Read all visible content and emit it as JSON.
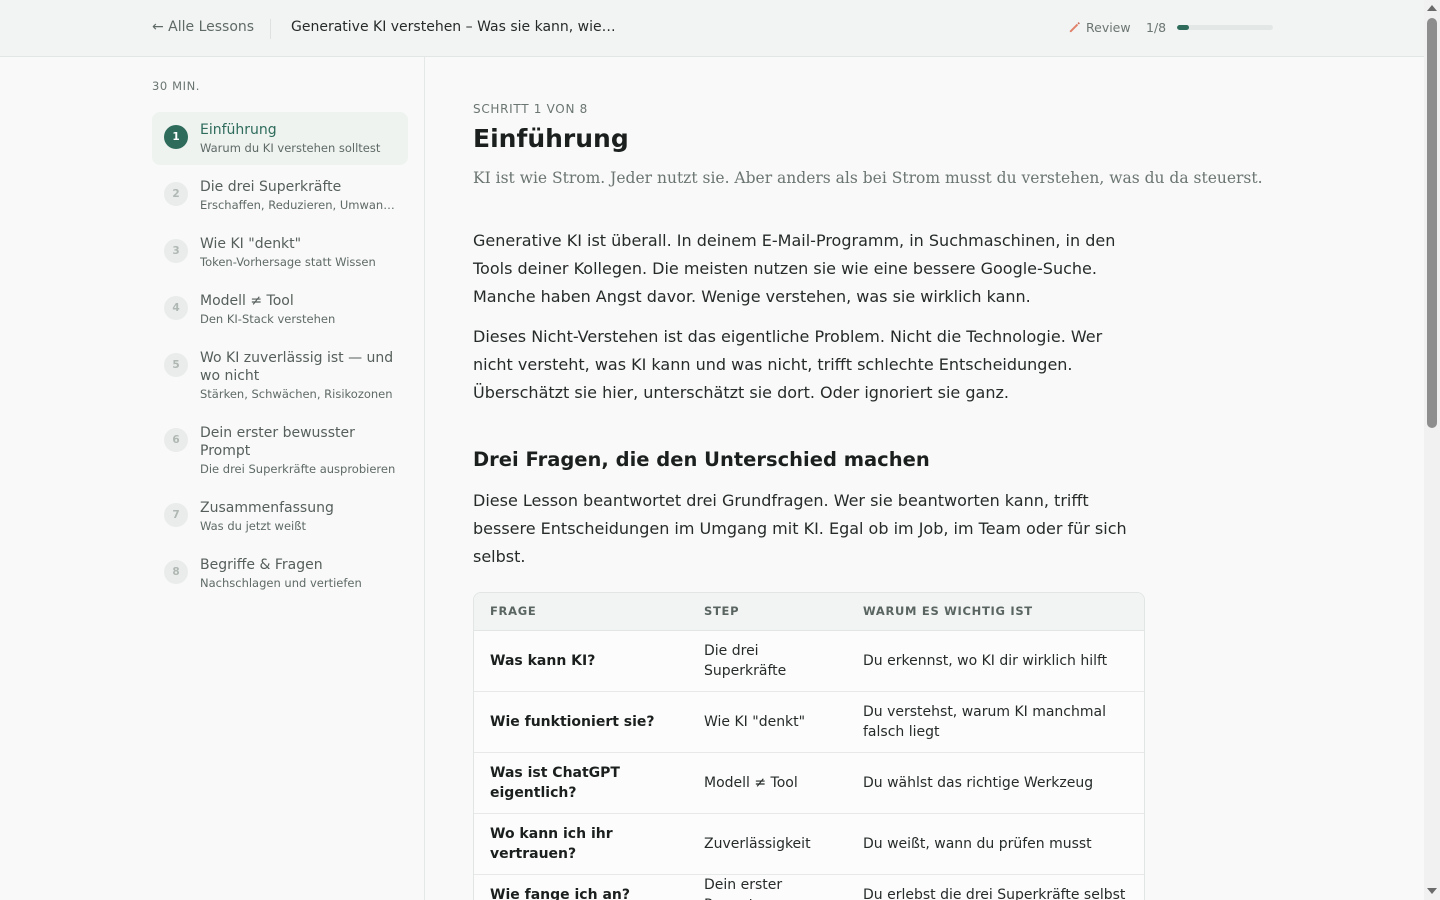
{
  "header": {
    "back_label": "← Alle Lessons",
    "lesson_title": "Generative KI verstehen – Was sie kann, wie…",
    "review_label": "Review",
    "progress_label": "1/8",
    "progress_fraction": 0.125,
    "accent_color": "#2e6b5b",
    "review_icon": "pencil-icon"
  },
  "sidebar": {
    "duration": "30 MIN.",
    "steps": [
      {
        "num": "1",
        "title": "Einführung",
        "subtitle": "Warum du KI verstehen solltest",
        "active": true
      },
      {
        "num": "2",
        "title": "Die drei Superkräfte",
        "subtitle": "Erschaffen, Reduzieren, Umwan…"
      },
      {
        "num": "3",
        "title": "Wie KI \"denkt\"",
        "subtitle": "Token-Vorhersage statt Wissen"
      },
      {
        "num": "4",
        "title": "Modell ≠ Tool",
        "subtitle": "Den KI-Stack verstehen"
      },
      {
        "num": "5",
        "title": "Wo KI zuverlässig ist — und wo nicht",
        "subtitle": "Stärken, Schwächen, Risikozonen"
      },
      {
        "num": "6",
        "title": "Dein erster bewusster Prompt",
        "subtitle": "Die drei Superkräfte ausprobieren"
      },
      {
        "num": "7",
        "title": "Zusammenfassung",
        "subtitle": "Was du jetzt weißt"
      },
      {
        "num": "8",
        "title": "Begriffe & Fragen",
        "subtitle": "Nachschlagen und vertiefen"
      }
    ]
  },
  "main": {
    "step_label": "SCHRITT 1 VON 8",
    "title": "Einführung",
    "lead": "KI ist wie Strom. Jeder nutzt sie. Aber anders als bei Strom musst du verstehen, was du da steuerst.",
    "paragraph1": "Generative KI ist überall. In deinem E-Mail-Programm, in Suchmaschinen, in den Tools deiner Kollegen. Die meisten nutzen sie wie eine bessere Google-Suche. Manche haben Angst davor. Wenige verstehen, was sie wirklich kann.",
    "paragraph2": "Dieses Nicht-Verstehen ist das eigentliche Problem. Nicht die Technologie. Wer nicht versteht, was KI kann und was nicht, trifft schlechte Entscheidungen. Überschätzt sie hier, unterschätzt sie dort. Oder ignoriert sie ganz.",
    "section_heading": "Drei Fragen, die den Unterschied machen",
    "paragraph3": "Diese Lesson beantwortet drei Grundfragen. Wer sie beantworten kann, trifft bessere Entscheidungen im Umgang mit KI. Egal ob im Job, im Team oder für sich selbst.",
    "table": {
      "headers": [
        "FRAGE",
        "STEP",
        "WARUM ES WICHTIG IST"
      ],
      "rows": [
        [
          "Was kann KI?",
          "Die drei Superkräfte",
          "Du erkennst, wo KI dir wirklich hilft"
        ],
        [
          "Wie funktioniert sie?",
          "Wie KI \"denkt\"",
          "Du verstehst, warum KI manchmal falsch liegt"
        ],
        [
          "Was ist ChatGPT eigentlich?",
          "Modell ≠ Tool",
          "Du wählst das richtige Werkzeug"
        ],
        [
          "Wo kann ich ihr vertrauen?",
          "Zuverlässigkeit",
          "Du weißt, wann du prüfen musst"
        ],
        [
          "Wie fange ich an?",
          "Dein erster Prompt",
          "Du erlebst die drei Superkräfte selbst"
        ]
      ]
    }
  }
}
